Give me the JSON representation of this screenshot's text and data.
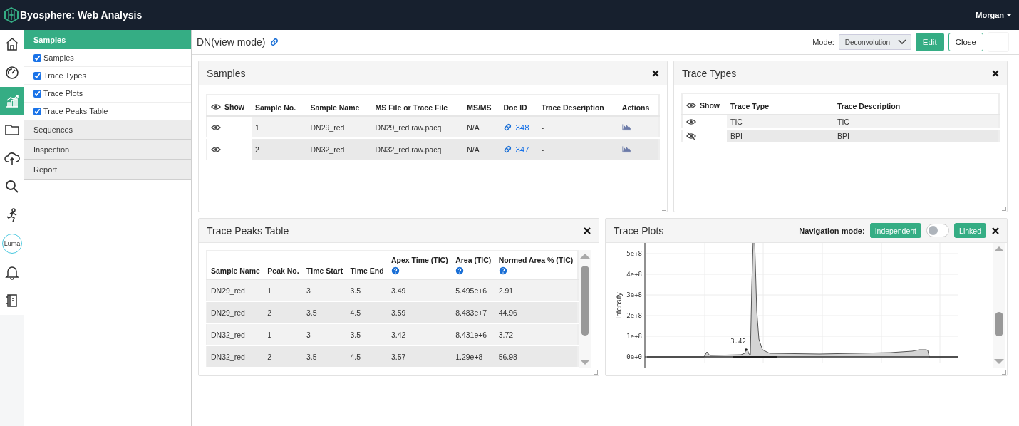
{
  "app": {
    "title": "Byosphere: Web Analysis",
    "user": "Morgan"
  },
  "rail": [
    {
      "kind": "home",
      "selected": false
    },
    {
      "kind": "gauge",
      "selected": false
    },
    {
      "kind": "chart",
      "selected": true
    },
    {
      "kind": "folder",
      "selected": false
    },
    {
      "kind": "upload",
      "selected": false
    },
    {
      "kind": "search",
      "selected": false
    },
    {
      "kind": "figure",
      "selected": false
    },
    {
      "kind": "luma",
      "label": "Luma",
      "selected": false
    },
    {
      "kind": "bell",
      "selected": false
    },
    {
      "kind": "notebook",
      "selected": false
    }
  ],
  "sidebar": [
    {
      "label": "Samples",
      "expanded": true,
      "items": [
        {
          "label": "Samples",
          "checked": true
        },
        {
          "label": "Trace Types",
          "checked": true
        },
        {
          "label": "Trace Plots",
          "checked": true
        },
        {
          "label": "Trace Peaks Table",
          "checked": true
        }
      ]
    },
    {
      "label": "Sequences",
      "expanded": false
    },
    {
      "label": "Inspection",
      "expanded": false
    },
    {
      "label": "Report",
      "expanded": false
    }
  ],
  "page": {
    "title": "DN(view mode)",
    "mode_label": "Mode:",
    "mode_value": "Deconvolution",
    "buttons": [
      {
        "label": "Edit",
        "kind": "primary"
      },
      {
        "label": "Close",
        "kind": "outline"
      }
    ]
  },
  "samples": {
    "title": "Samples",
    "columns": [
      "Show",
      "Sample No.",
      "Sample Name",
      "MS File or Trace File",
      "MS/MS",
      "Doc ID",
      "Trace Description",
      "Actions"
    ],
    "rows": [
      {
        "visible": true,
        "cells": [
          "",
          "1",
          "DN29_red",
          "DN29_red.raw.pacq",
          "N/A",
          "348",
          "-",
          ""
        ]
      },
      {
        "visible": true,
        "cells": [
          "",
          "2",
          "DN32_red",
          "DN32_red.raw.pacq",
          "N/A",
          "347",
          "-",
          ""
        ]
      }
    ]
  },
  "trace_types": {
    "title": "Trace Types",
    "columns": [
      "Show",
      "Trace Type",
      "Trace Description"
    ],
    "rows": [
      {
        "visible": true,
        "cells": [
          "",
          "TIC",
          "TIC"
        ]
      },
      {
        "visible": false,
        "cells": [
          "",
          "BPI",
          "BPI"
        ]
      }
    ]
  },
  "peaks": {
    "title": "Trace Peaks Table",
    "columns": [
      {
        "label": "Sample Name",
        "help": false
      },
      {
        "label": "Peak No.",
        "help": false
      },
      {
        "label": "Time Start",
        "help": false
      },
      {
        "label": "Time End",
        "help": false
      },
      {
        "label": "Apex Time (TIC)",
        "help": true
      },
      {
        "label": "Area (TIC)",
        "help": true
      },
      {
        "label": "Normed Area % (TIC)",
        "help": true
      }
    ],
    "rows": [
      [
        "DN29_red",
        "1",
        "3",
        "3.5",
        "3.49",
        "5.495e+6",
        "2.91"
      ],
      [
        "DN29_red",
        "2",
        "3.5",
        "4.5",
        "3.59",
        "8.483e+7",
        "44.96"
      ],
      [
        "DN32_red",
        "1",
        "3",
        "3.5",
        "3.42",
        "8.431e+6",
        "3.72"
      ],
      [
        "DN32_red",
        "2",
        "3.5",
        "4.5",
        "3.57",
        "1.29e+8",
        "56.98"
      ]
    ]
  },
  "plots": {
    "title": "Trace Plots",
    "nav_label": "Navigation mode:",
    "independent_label": "Independent",
    "linked_label": "Linked",
    "linked_on": false,
    "y_axis_title": "Intensity",
    "y_tick_labels": [
      "5e+8",
      "4e+8",
      "3e+8",
      "2e+8",
      "1e+8",
      "0e+0"
    ],
    "peak_label": "3.42"
  }
}
